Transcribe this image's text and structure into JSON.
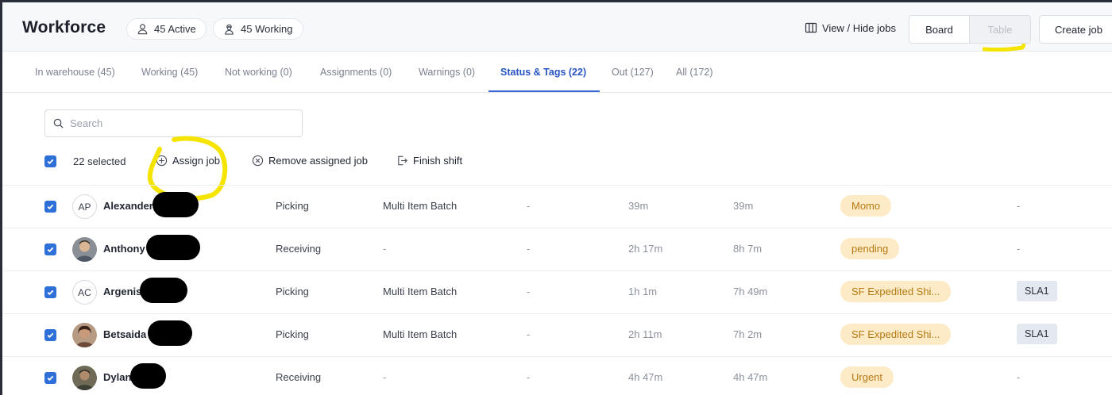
{
  "header": {
    "title": "Workforce",
    "active_label": "45 Active",
    "working_label": "45 Working",
    "view_hide_label": "View / Hide jobs",
    "board_label": "Board",
    "table_label": "Table",
    "create_label": "Create job"
  },
  "tabs": [
    {
      "label": "In warehouse (45)"
    },
    {
      "label": "Working (45)"
    },
    {
      "label": "Not working (0)"
    },
    {
      "label": "Assignments (0)"
    },
    {
      "label": "Warnings (0)"
    },
    {
      "label": "Status & Tags (22)"
    },
    {
      "label": "Out (127)"
    },
    {
      "label": "All (172)"
    }
  ],
  "search": {
    "placeholder": "Search"
  },
  "toolbar": {
    "selected_label": "22 selected",
    "assign_label": "Assign job",
    "remove_label": "Remove assigned job",
    "finish_label": "Finish shift"
  },
  "rows": [
    {
      "initials": "AP",
      "name": "Alexander",
      "job": "Picking",
      "batch": "Multi Item Batch",
      "dash": "-",
      "time1": "39m",
      "time2": "39m",
      "tag": "Momo",
      "badge": "-"
    },
    {
      "initials": "",
      "name": "Anthony",
      "job": "Receiving",
      "batch": "-",
      "dash": "-",
      "time1": "2h 17m",
      "time2": "8h 7m",
      "tag": "pending",
      "badge": "-"
    },
    {
      "initials": "AC",
      "name": "Argenis",
      "job": "Picking",
      "batch": "Multi Item Batch",
      "dash": "-",
      "time1": "1h 1m",
      "time2": "7h 49m",
      "tag": "SF Expedited Shi...",
      "badge": "SLA1"
    },
    {
      "initials": "",
      "name": "Betsaida",
      "job": "Picking",
      "batch": "Multi Item Batch",
      "dash": "-",
      "time1": "2h 11m",
      "time2": "7h 2m",
      "tag": "SF Expedited Shi...",
      "badge": "SLA1"
    },
    {
      "initials": "",
      "name": "Dylan",
      "job": "Receiving",
      "batch": "-",
      "dash": "-",
      "time1": "4h 47m",
      "time2": "4h 47m",
      "tag": "Urgent",
      "badge": "-"
    }
  ],
  "colors": {
    "accent": "#2f6fd8",
    "tab_active": "#2a55c5",
    "tag_bg": "#fdebc8",
    "tag_text": "#b57a12",
    "marker": "#f5e400"
  }
}
